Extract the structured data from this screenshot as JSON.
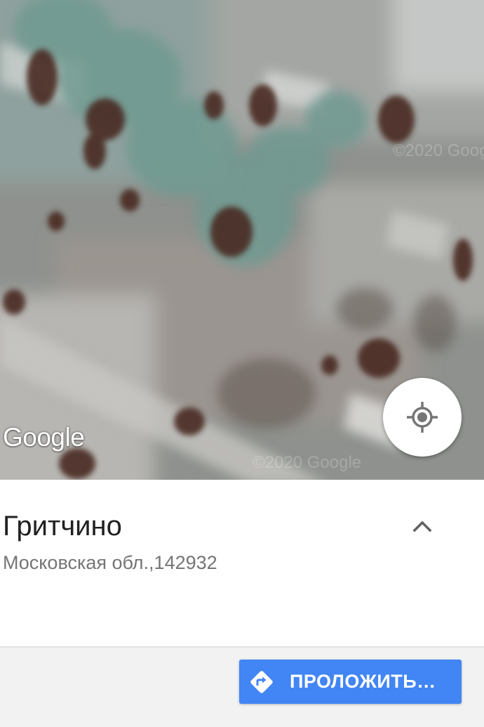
{
  "map": {
    "type": "satellite",
    "logo_text": "Google",
    "watermark_text": "©2020 Google",
    "my_location_icon": "my-location-icon"
  },
  "place": {
    "title": "Гритчино",
    "address": "Московская обл.,142932",
    "expand_icon": "chevron-up-icon"
  },
  "actions": {
    "directions_label": "ПРОЛОЖИТЬ…",
    "directions_icon": "directions-icon"
  },
  "colors": {
    "accent": "#4285f4",
    "title_text": "#212121",
    "secondary_text": "#757575",
    "action_bar_bg": "#f2f2f2"
  }
}
